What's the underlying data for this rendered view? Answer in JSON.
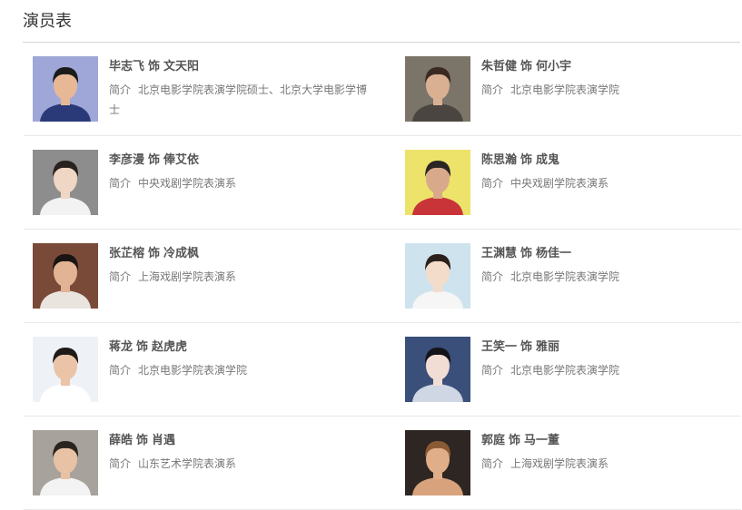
{
  "section": {
    "title": "演员表"
  },
  "cast": [
    {
      "actor": "毕志飞",
      "role_sep": "饰",
      "role": "文天阳",
      "intro_label": "简介",
      "intro": "北京电影学院表演学院硕士、北京大学电影学博士",
      "colors": {
        "bg": "#9fa7d8",
        "hair": "#1b1b1b",
        "skin": "#e8b896",
        "clothes": "#2a3a78"
      }
    },
    {
      "actor": "朱哲健",
      "role_sep": "饰",
      "role": "何小宇",
      "intro_label": "简介",
      "intro": "北京电影学院表演学院",
      "colors": {
        "bg": "#7b7468",
        "hair": "#3a2a22",
        "skin": "#d9b092",
        "clothes": "#4a4540"
      }
    },
    {
      "actor": "李彦漫",
      "role_sep": "饰",
      "role": "俸艾依",
      "intro_label": "简介",
      "intro": "中央戏剧学院表演系",
      "colors": {
        "bg": "#8d8d8d",
        "hair": "#2a221e",
        "skin": "#f0d6c4",
        "clothes": "#f2f2f2"
      }
    },
    {
      "actor": "陈思瀚",
      "role_sep": "饰",
      "role": "成鬼",
      "intro_label": "简介",
      "intro": "中央戏剧学院表演系",
      "colors": {
        "bg": "#ede36a",
        "hair": "#2b2624",
        "skin": "#d8a98a",
        "clothes": "#c93438"
      }
    },
    {
      "actor": "张芷榕",
      "role_sep": "饰",
      "role": "冷成枫",
      "intro_label": "简介",
      "intro": "上海戏剧学院表演系",
      "colors": {
        "bg": "#7a4a38",
        "hair": "#1a1412",
        "skin": "#e2b394",
        "clothes": "#e9e4de"
      }
    },
    {
      "actor": "王渊慧",
      "role_sep": "饰",
      "role": "杨佳一",
      "intro_label": "简介",
      "intro": "北京电影学院表演学院",
      "colors": {
        "bg": "#cfe3ef",
        "hair": "#2a201c",
        "skin": "#f4dccb",
        "clothes": "#f6f6f6"
      }
    },
    {
      "actor": "蒋龙",
      "role_sep": "饰",
      "role": "赵虎虎",
      "intro_label": "简介",
      "intro": "北京电影学院表演学院",
      "colors": {
        "bg": "#eef2f7",
        "hair": "#1d1a18",
        "skin": "#ebc3a6",
        "clothes": "#ffffff"
      }
    },
    {
      "actor": "王笑一",
      "role_sep": "饰",
      "role": "雅丽",
      "intro_label": "简介",
      "intro": "北京电影学院表演学院",
      "colors": {
        "bg": "#3a4f7a",
        "hair": "#15131a",
        "skin": "#f2ddd4",
        "clothes": "#cfd6e4"
      }
    },
    {
      "actor": "薛皓",
      "role_sep": "饰",
      "role": "肖遇",
      "intro_label": "简介",
      "intro": "山东艺术学院表演系",
      "colors": {
        "bg": "#a7a39c",
        "hair": "#2a2420",
        "skin": "#e7c2a4",
        "clothes": "#f3f3f3"
      }
    },
    {
      "actor": "郭庭",
      "role_sep": "饰",
      "role": "马一董",
      "intro_label": "简介",
      "intro": "上海戏剧学院表演系",
      "colors": {
        "bg": "#2e2622",
        "hair": "#8a5a34",
        "skin": "#e0ae88",
        "clothes": "#d7a27c"
      }
    }
  ]
}
